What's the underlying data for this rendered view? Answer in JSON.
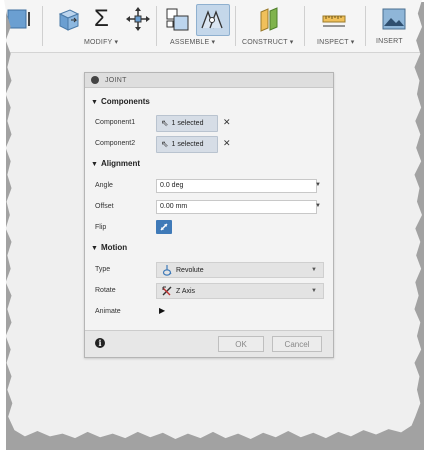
{
  "toolbar": {
    "groups": [
      {
        "label": "MODIFY ▾"
      },
      {
        "label": "ASSEMBLE ▾"
      },
      {
        "label": "CONSTRUCT ▾"
      },
      {
        "label": "INSPECT ▾"
      },
      {
        "label": "INSERT"
      }
    ],
    "sigma": "Σ"
  },
  "dialog": {
    "title": "JOINT",
    "components": {
      "heading": "Components",
      "component1_label": "Component1",
      "component1_value": "1 selected",
      "component2_label": "Component2",
      "component2_value": "1 selected",
      "clear": "✕"
    },
    "alignment": {
      "heading": "Alignment",
      "angle_label": "Angle",
      "angle_value": "0.0 deg",
      "offset_label": "Offset",
      "offset_value": "0.00 mm",
      "flip_label": "Flip"
    },
    "motion": {
      "heading": "Motion",
      "type_label": "Type",
      "type_value": "Revolute",
      "rotate_label": "Rotate",
      "rotate_value": "Z Axis",
      "animate_label": "Animate"
    },
    "footer": {
      "ok": "OK",
      "cancel": "Cancel"
    }
  },
  "colors": {
    "accent": "#3f7ab8",
    "selection_box": "#d6dde6",
    "header": "#dedede"
  }
}
